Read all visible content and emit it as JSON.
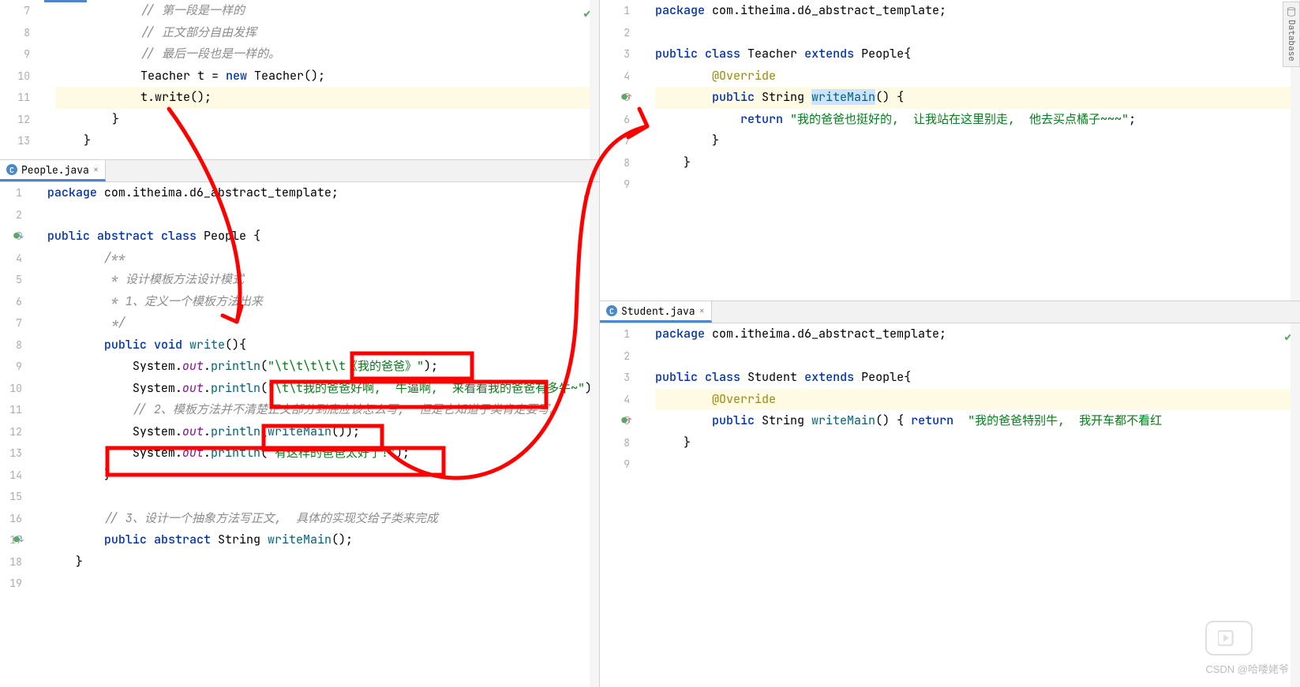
{
  "sideTab": "Database",
  "watermark": "CSDN @哈喽姥爷",
  "panes": {
    "topLeft": {
      "lines": [
        {
          "n": 7,
          "cls": "cmt",
          "txt": "            // 第一段是一样的"
        },
        {
          "n": 8,
          "cls": "cmt",
          "txt": "            // 正文部分自由发挥"
        },
        {
          "n": 9,
          "cls": "cmt",
          "txt": "            // 最后一段也是一样的。"
        },
        {
          "n": 10,
          "txt": "            Teacher t = |new| Teacher();",
          "kw": [
            "new"
          ]
        },
        {
          "n": 11,
          "hl": true,
          "txt": "            t.write();"
        },
        {
          "n": 12,
          "txt": "        }"
        },
        {
          "n": 13,
          "txt": "    }"
        }
      ]
    },
    "botLeft": {
      "tab": "People.java",
      "lines": [
        {
          "n": 1,
          "kw": [
            "package"
          ],
          "txt": "|package| com.itheima.d6_abstract_template;"
        },
        {
          "n": 2,
          "txt": ""
        },
        {
          "n": 3,
          "mark": "impl",
          "kw": [
            "public",
            "abstract",
            "class"
          ],
          "txt": "|public| |abstract| |class| People {"
        },
        {
          "n": 4,
          "cls": "cmt",
          "txt": "        /**"
        },
        {
          "n": 5,
          "cls": "cmt",
          "txt": "         * 设计模板方法设计模式"
        },
        {
          "n": 6,
          "cls": "cmt",
          "txt": "         * 1、定义一个模板方法出来"
        },
        {
          "n": 7,
          "cls": "cmt",
          "txt": "         */"
        },
        {
          "n": 8,
          "kw": [
            "public",
            "void"
          ],
          "mth": [
            "write"
          ],
          "txt": "        |public| |void| ~write~(){"
        },
        {
          "n": 9,
          "fld": [
            "out"
          ],
          "mth": [
            "println"
          ],
          "str": [
            "\"\\t\\t\\t\\t\\t《我的爸爸》\""
          ],
          "txt": "            System.^out^.~println~(`\"\\t\\t\\t\\t\\t《我的爸爸》\"`);"
        },
        {
          "n": 10,
          "fld": [
            "out"
          ],
          "mth": [
            "println"
          ],
          "str": [
            "\"\\t\\t我的爸爸好啊,  牛逼啊,  来看看我的爸爸有多牛~\""
          ],
          "txt": "            System.^out^.~println~(`\"\\t\\t我的爸爸好啊,  牛逼啊,  来看看我的爸爸有多牛~\"`);"
        },
        {
          "n": 11,
          "cls": "cmt",
          "txt": "            // 2、模板方法并不清楚正文部分到底应该怎么写,  但是它知道子类肯定要写。"
        },
        {
          "n": 12,
          "fld": [
            "out"
          ],
          "mth": [
            "println",
            "writeMain"
          ],
          "txt": "            System.^out^.~println~(~writeMain~());"
        },
        {
          "n": 13,
          "fld": [
            "out"
          ],
          "mth": [
            "println"
          ],
          "str": [
            "\"有这样的爸爸太好了!\""
          ],
          "txt": "            System.^out^.~println~(`\"有这样的爸爸太好了!\"`);"
        },
        {
          "n": 14,
          "txt": "        }"
        },
        {
          "n": 15,
          "txt": ""
        },
        {
          "n": 16,
          "cls": "cmt",
          "txt": "        // 3、设计一个抽象方法写正文,  具体的实现交给子类来完成"
        },
        {
          "n": 17,
          "mark": "impl",
          "kw": [
            "public",
            "abstract"
          ],
          "mth": [
            "writeMain"
          ],
          "txt": "        |public| |abstract| String ~writeMain~();"
        },
        {
          "n": 18,
          "txt": "    }"
        },
        {
          "n": 19,
          "txt": ""
        }
      ]
    },
    "topRight": {
      "lines": [
        {
          "n": 1,
          "kw": [
            "package"
          ],
          "txt": "|package| com.itheima.d6_abstract_template;"
        },
        {
          "n": 2,
          "txt": ""
        },
        {
          "n": 3,
          "kw": [
            "public",
            "class",
            "extends"
          ],
          "txt": "|public| |class| Teacher |extends| People{"
        },
        {
          "n": 4,
          "ann": [
            "@Override"
          ],
          "txt": "        #@Override#"
        },
        {
          "n": 5,
          "hl": true,
          "mark": "over",
          "kw": [
            "public"
          ],
          "mth": [
            "writeMain"
          ],
          "sel": "writeMain",
          "txt": "        |public| String ~writeMain~() {"
        },
        {
          "n": 6,
          "kw": [
            "return"
          ],
          "str": [
            "\"我的爸爸也挺好的,  让我站在这里别走,  他去买点橘子~~~\""
          ],
          "txt": "            |return| `\"我的爸爸也挺好的,  让我站在这里别走,  他去买点橘子~~~\"`;"
        },
        {
          "n": 7,
          "txt": "        }"
        },
        {
          "n": 8,
          "txt": "    }"
        },
        {
          "n": 9,
          "txt": ""
        }
      ]
    },
    "botRight": {
      "tab": "Student.java",
      "lines": [
        {
          "n": 1,
          "kw": [
            "package"
          ],
          "txt": "|package| com.itheima.d6_abstract_template;"
        },
        {
          "n": 2,
          "txt": ""
        },
        {
          "n": 3,
          "kw": [
            "public",
            "class",
            "extends"
          ],
          "txt": "|public| |class| Student |extends| People{"
        },
        {
          "n": 4,
          "hl": true,
          "ann": [
            "@Override"
          ],
          "txt": "        #@Override#"
        },
        {
          "n": 5,
          "mark": "over",
          "kw": [
            "public",
            "return"
          ],
          "mth": [
            "writeMain"
          ],
          "str": [
            "\"我的爸爸特别牛,  我开车都不看红"
          ],
          "txt": "        |public| String ~writeMain~() { |return|  `\"我的爸爸特别牛,  我开车都不看红`"
        },
        {
          "n": 8,
          "txt": "    }"
        },
        {
          "n": 9,
          "txt": ""
        }
      ]
    }
  }
}
